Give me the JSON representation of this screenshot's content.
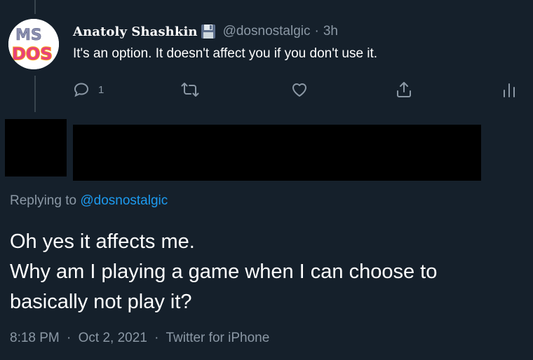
{
  "reply_tweet": {
    "display_name": "Anatoly Shashkin",
    "handle": "@dosnostalgic",
    "separator": "·",
    "time": "3h",
    "text": "It's an option. It doesn't affect you if you don't use it.",
    "reply_count": "1",
    "avatar_letters_top": "MS",
    "avatar_letters_bottom": "DOS"
  },
  "main_tweet": {
    "replying_label": "Replying to",
    "replying_handle": "@dosnostalgic",
    "lines": [
      "Oh yes it affects me.",
      "Why am I playing a game when I can choose to",
      "basically not play it?"
    ],
    "time": "8:18 PM",
    "date": "Oct 2, 2021",
    "source": "Twitter for iPhone",
    "separator": "·"
  },
  "colors": {
    "background": "#15202b",
    "text": "#ffffff",
    "secondary_text": "#8b98a5",
    "link": "#1d9bf0",
    "redaction": "#000000"
  },
  "icons": {
    "reply": "reply-icon",
    "retweet": "retweet-icon",
    "like": "like-icon",
    "share": "share-icon",
    "analytics": "analytics-icon",
    "floppy": "floppy-disk-icon"
  }
}
